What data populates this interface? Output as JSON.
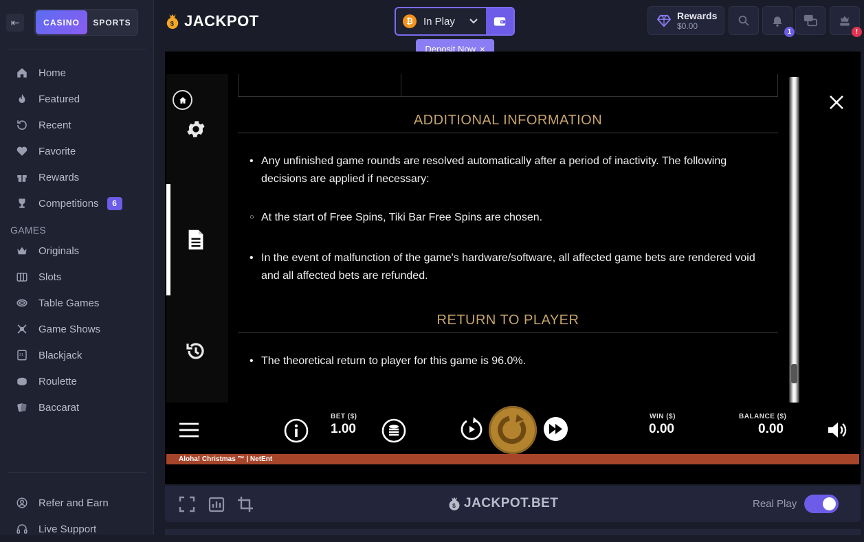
{
  "sidebar": {
    "switcher": {
      "casino": "CASINO",
      "sports": "SPORTS"
    },
    "nav": [
      {
        "label": "Home",
        "icon": "home-icon"
      },
      {
        "label": "Featured",
        "icon": "flame-icon"
      },
      {
        "label": "Recent",
        "icon": "recent-icon"
      },
      {
        "label": "Favorite",
        "icon": "heart-icon"
      },
      {
        "label": "Rewards",
        "icon": "gift-icon"
      },
      {
        "label": "Competitions",
        "icon": "trophy-icon",
        "badge": "6"
      }
    ],
    "games_title": "GAMES",
    "games": [
      {
        "label": "Originals",
        "icon": "crown-icon"
      },
      {
        "label": "Slots",
        "icon": "slots-icon"
      },
      {
        "label": "Table Games",
        "icon": "table-icon"
      },
      {
        "label": "Game Shows",
        "icon": "game-shows-icon"
      },
      {
        "label": "Blackjack",
        "icon": "blackjack-icon"
      },
      {
        "label": "Roulette",
        "icon": "roulette-icon"
      },
      {
        "label": "Baccarat",
        "icon": "baccarat-icon"
      }
    ],
    "bottom": [
      {
        "label": "Refer and Earn",
        "icon": "refer-icon"
      },
      {
        "label": "Live Support",
        "icon": "headset-icon"
      }
    ]
  },
  "header": {
    "logo": "JACKPOT",
    "currency_label": "In Play",
    "deposit_label": "Deposit Now",
    "rewards_title": "Rewards",
    "rewards_amount": "$0.00",
    "notifications_badge": "1",
    "profile_badge": "!"
  },
  "game": {
    "sections": [
      {
        "heading": "ADDITIONAL INFORMATION",
        "bullets": [
          "Any unfinished game rounds are resolved automatically after a period of inactivity. The following decisions are applied if necessary:",
          "At the start of Free Spins, Tiki Bar Free Spins are chosen.",
          "In the event of malfunction of the game's hardware/software, all affected game bets are rendered void and all affected bets are refunded."
        ]
      },
      {
        "heading": "RETURN TO PLAYER",
        "bullets": [
          "The theoretical return to player for this game is 96.0%."
        ]
      }
    ],
    "bet_label": "BET ($)",
    "bet_value": "1.00",
    "win_label": "WIN ($)",
    "win_value": "0.00",
    "balance_label": "BALANCE ($)",
    "balance_value": "0.00",
    "footer_text": "Aloha! Christmas ™  |  NetEnt"
  },
  "bottombar": {
    "logo": "JACKPOT.BET",
    "mode_label": "Real Play",
    "real_play_on": true
  },
  "colors": {
    "accent": "#6c5ce7",
    "gold": "#c7a46a",
    "spin": "#b3832e",
    "strip": "#a7452a"
  }
}
